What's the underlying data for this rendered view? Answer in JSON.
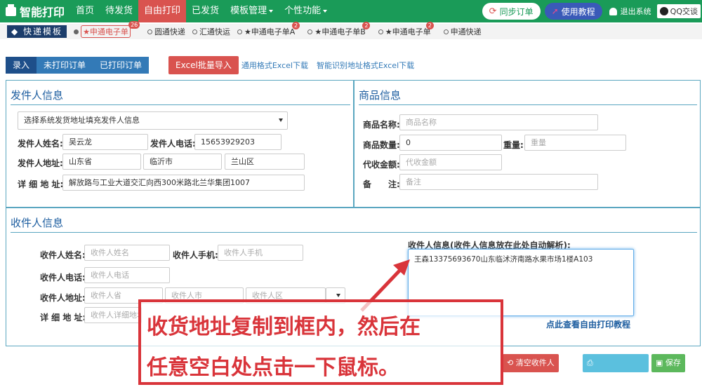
{
  "nav": {
    "brand": "智能打印",
    "items": [
      "首页",
      "待发货",
      "自由打印",
      "已发货",
      "模板管理",
      "个性功能"
    ],
    "active_color": "#d9534f",
    "bar_color": "#1a9b58"
  },
  "topright": {
    "sync": "同步订单",
    "tutorial": "使用教程",
    "logout": "退出系统",
    "qq": "QQ交谈"
  },
  "templates": {
    "title": "快递模板",
    "options": [
      {
        "label": "★申通电子单",
        "badge": "26",
        "selected": true
      },
      {
        "label": "圆通快递",
        "badge": "",
        "selected": false
      },
      {
        "label": "汇通快运",
        "badge": "",
        "selected": false
      },
      {
        "label": "★申通电子单A",
        "badge": "2",
        "selected": false
      },
      {
        "label": "★申通电子单B",
        "badge": "2",
        "selected": false
      },
      {
        "label": "★申通电子单",
        "badge": "2",
        "selected": false
      },
      {
        "label": "申通快递",
        "badge": "",
        "selected": false
      }
    ]
  },
  "actions": {
    "tabs": [
      "录入",
      "未打印订单",
      "已打印订单"
    ],
    "excel": "Excel批量导入",
    "link1": "通用格式Excel下载",
    "link2": "智能识别地址格式Excel下载"
  },
  "sender": {
    "title": "发件人信息",
    "select": "选择系统发货地址填充发件人信息",
    "name_label": "发件人姓名:",
    "name": "吴云龙",
    "phone_label": "发件人电话:",
    "phone": "15653929203",
    "addr_label": "发件人地址:",
    "province": "山东省",
    "city": "临沂市",
    "district": "兰山区",
    "detail_label": "详 细 地 址:",
    "detail": "解放路与工业大道交汇向西300米路北兰华集团1007"
  },
  "goods": {
    "title": "商品信息",
    "name_label": "商品名称:",
    "name_ph": "商品名称",
    "qty_label": "商品数量:",
    "qty": "0",
    "weight_label": "重量:",
    "weight_ph": "重量",
    "cod_label": "代收金额:",
    "cod_ph": "代收金额",
    "note_label": "备　　注:",
    "note_ph": "备注"
  },
  "receiver": {
    "title": "收件人信息",
    "name_label": "收件人姓名:",
    "name_ph": "收件人姓名",
    "mobile_label": "收件人手机:",
    "mobile_ph": "收件人手机",
    "tel_label": "收件人电话:",
    "tel_ph": "收件人电话",
    "addr_label": "收件人地址:",
    "province_ph": "收件人省",
    "city_ph": "收件人市",
    "district_ph": "收件人区",
    "detail_label": "详 细 地 址:",
    "detail_ph": "收件人详细地址",
    "info_label": "收件人信息(收件人信息放在此处自动解析):",
    "info_text": "王森13375693670山东临沭济南路水果市场1楼A103",
    "help_link": "点此查看自由打印教程"
  },
  "callout": {
    "line1": "收货地址复制到框内，然后在",
    "line2": "任意空白处点击一下鼠标。"
  },
  "bottom": {
    "clear": "清空收件人",
    "save": "保存"
  }
}
